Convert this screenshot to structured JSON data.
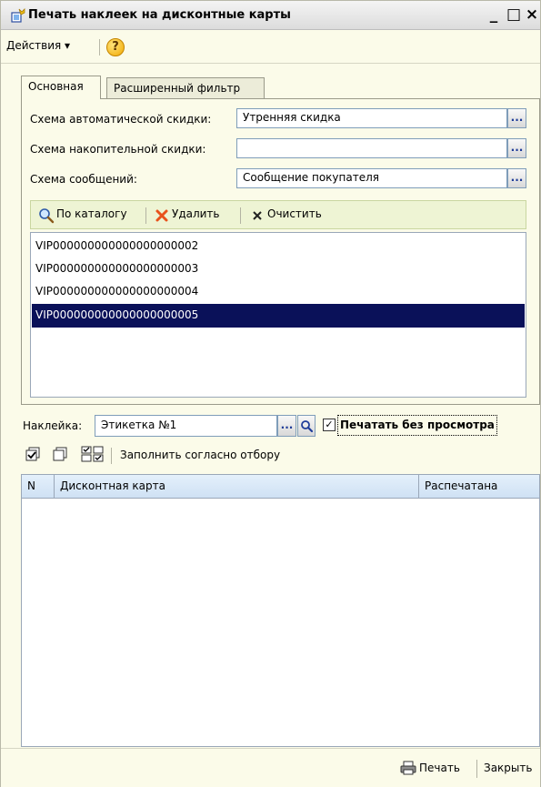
{
  "window": {
    "title": "Печать наклеек на дисконтные карты",
    "controls": {
      "minimize": "_",
      "maximize": "□",
      "close": "×"
    }
  },
  "menubar": {
    "actions_label": "Действия ▾",
    "help_glyph": "?"
  },
  "tabs": [
    {
      "label": "Основная",
      "active": true
    },
    {
      "label": "Расширенный фильтр",
      "active": false
    }
  ],
  "fields": {
    "auto_discount": {
      "label": "Схема автоматической скидки:",
      "value": "Утренняя скидка"
    },
    "cumulative_discount": {
      "label": "Схема накопительной скидки:",
      "value": ""
    },
    "messages": {
      "label": "Схема сообщений:",
      "value": "Сообщение покупателя"
    },
    "dots_glyph": "..."
  },
  "list_toolbar": {
    "catalog": "По каталогу",
    "delete": "Удалить",
    "clear": "Очистить"
  },
  "codes": [
    {
      "code": "VIP000000000000000000002",
      "selected": false
    },
    {
      "code": "VIP000000000000000000003",
      "selected": false
    },
    {
      "code": "VIP000000000000000000004",
      "selected": false
    },
    {
      "code": "VIP000000000000000000005",
      "selected": true
    }
  ],
  "sticker": {
    "label": "Наклейка:",
    "value": "Этикетка №1",
    "print_without_preview": "Печатать без просмотра",
    "checked_glyph": "✓"
  },
  "toolbar2": {
    "fill_label": "Заполнить согласно отбору"
  },
  "grid": {
    "columns": [
      "N",
      "Дисконтная карта",
      "Распечатана"
    ]
  },
  "bottom": {
    "print": "Печать",
    "close": "Закрыть"
  },
  "colors": {
    "background": "#fbfbe9",
    "selection": "#0a1159",
    "header": "#cfe1f4",
    "delete_icon": "#e8521c"
  }
}
